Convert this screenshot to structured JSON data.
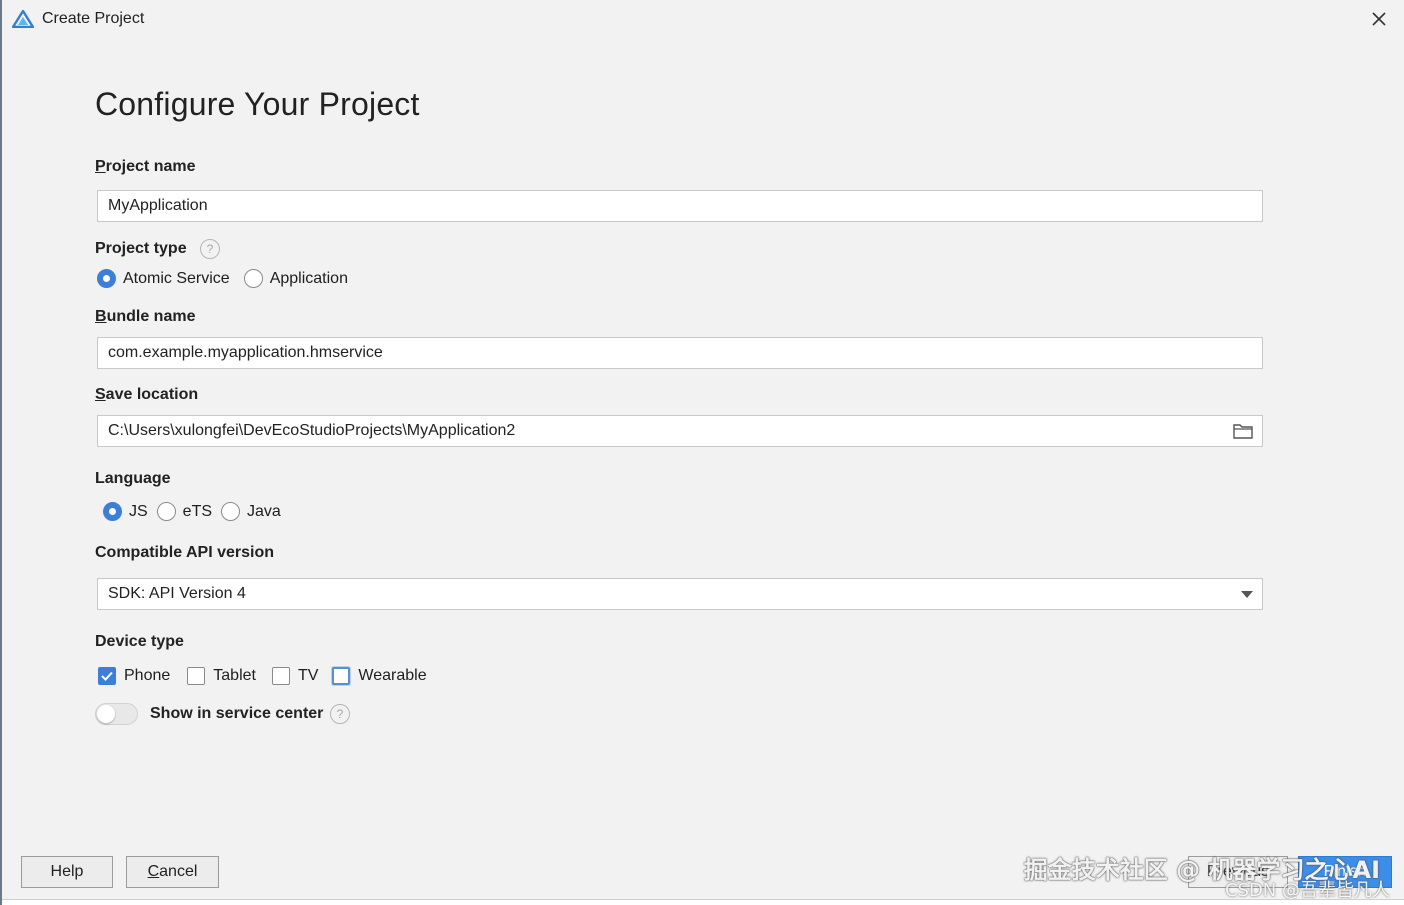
{
  "window": {
    "title": "Create Project",
    "close_glyph": "✕"
  },
  "page": {
    "heading": "Configure Your Project"
  },
  "form": {
    "project_name": {
      "label_mnemonic": "P",
      "label_rest": "roject name",
      "value": "MyApplication"
    },
    "project_type": {
      "label": "Project type",
      "help_glyph": "?",
      "options": [
        "Atomic Service",
        "Application"
      ],
      "selected": "Atomic Service"
    },
    "bundle_name": {
      "label_mnemonic": "B",
      "label_rest": "undle name",
      "value": "com.example.myapplication.hmservice"
    },
    "save_location": {
      "label_mnemonic": "S",
      "label_rest": "ave location",
      "value": "C:\\Users\\xulongfei\\DevEcoStudioProjects\\MyApplication2"
    },
    "language": {
      "label": "Language",
      "options": [
        "JS",
        "eTS",
        "Java"
      ],
      "selected": "JS"
    },
    "api_version": {
      "label": "Compatible API version",
      "value": "SDK: API Version 4"
    },
    "device_type": {
      "label": "Device type",
      "options": [
        {
          "label": "Phone",
          "checked": true
        },
        {
          "label": "Tablet",
          "checked": false
        },
        {
          "label": "TV",
          "checked": false
        },
        {
          "label": "Wearable",
          "checked": false
        }
      ]
    },
    "service_center": {
      "label": "Show in service center",
      "enabled": false,
      "help_glyph": "?"
    }
  },
  "footer": {
    "help_label": "Help",
    "cancel_mnemonic": "C",
    "cancel_rest": "ancel",
    "previous_label": "Previous",
    "finish_label": "Finish"
  },
  "watermark": {
    "line1": "掘金技术社区 @ 机器学习之心AI",
    "line2": "CSDN @吾辈皆凡人"
  },
  "colors": {
    "accent": "#3d7fd8",
    "background": "#f2f2f2"
  }
}
